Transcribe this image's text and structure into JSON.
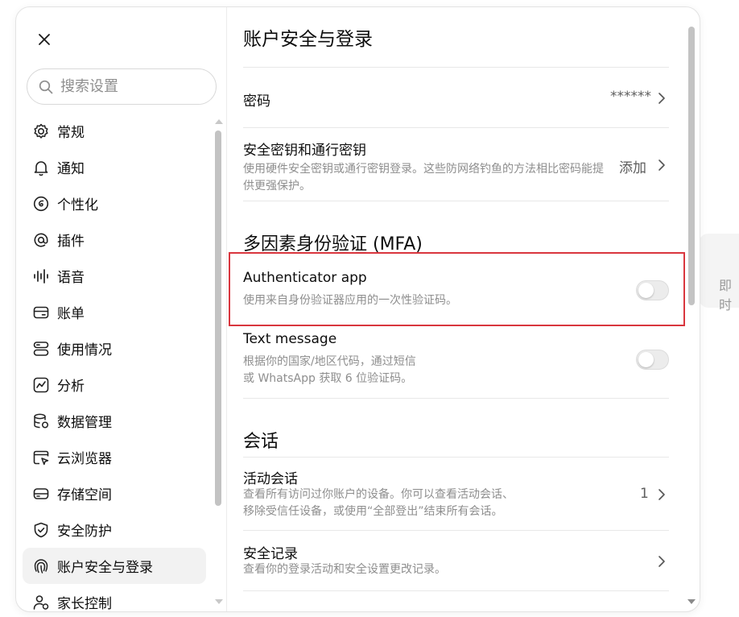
{
  "background_panel": {
    "text": "即时"
  },
  "sidebar": {
    "search_placeholder": "搜索设置",
    "items": [
      {
        "label": "常规",
        "icon": "gear-icon"
      },
      {
        "label": "通知",
        "icon": "bell-icon"
      },
      {
        "label": "个性化",
        "icon": "personalize-icon"
      },
      {
        "label": "插件",
        "icon": "at-icon"
      },
      {
        "label": "语音",
        "icon": "waveform-icon"
      },
      {
        "label": "账单",
        "icon": "card-icon"
      },
      {
        "label": "使用情况",
        "icon": "usage-icon"
      },
      {
        "label": "分析",
        "icon": "chart-icon"
      },
      {
        "label": "数据管理",
        "icon": "database-icon"
      },
      {
        "label": "云浏览器",
        "icon": "cloud-browser-icon"
      },
      {
        "label": "存储空间",
        "icon": "storage-icon"
      },
      {
        "label": "安全防护",
        "icon": "shield-icon"
      },
      {
        "label": "账户安全与登录",
        "icon": "fingerprint-icon",
        "active": true
      },
      {
        "label": "家长控制",
        "icon": "parental-icon"
      }
    ]
  },
  "main": {
    "title": "账户安全与登录",
    "password": {
      "title": "密码",
      "value": "******"
    },
    "passkeys": {
      "title": "安全密钥和通行密钥",
      "desc": "使用硬件安全密钥或通行密钥登录。这些防网络钓鱼的方法相比密码能提供更强保护。",
      "action": "添加"
    },
    "mfa_title": "多因素身份验证 (MFA)",
    "authenticator": {
      "title": "Authenticator app",
      "desc": "使用来自身份验证器应用的一次性验证码。",
      "enabled": false
    },
    "text_message": {
      "title": "Text message",
      "desc_line1": "根据你的国家/地区代码，通过短信",
      "desc_line2": "或 WhatsApp 获取 6 位验证码。",
      "enabled": false
    },
    "sessions_title": "会话",
    "active_sessions": {
      "title": "活动会话",
      "desc_line1": "查看所有访问过你账户的设备。你可以查看活动会话、",
      "desc_line2": "移除受信任设备，或使用“全部登出”结束所有会话。",
      "count": "1"
    },
    "security_log": {
      "title": "安全记录",
      "desc": "查看你的登录活动和安全设置更改记录。"
    }
  },
  "colors": {
    "highlight": "#d9363e",
    "toggle_off": "#ececec"
  }
}
